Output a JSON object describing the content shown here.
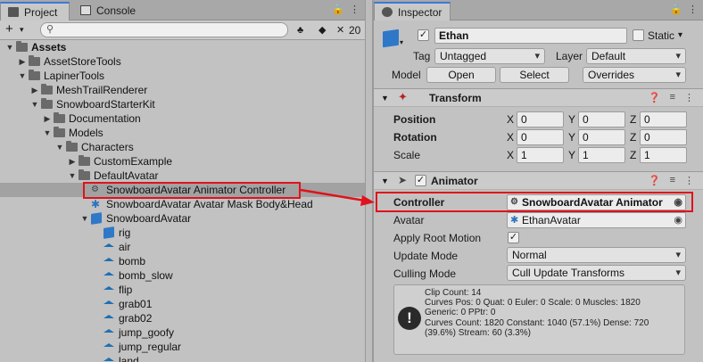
{
  "project_panel": {
    "tab_project": "Project",
    "tab_console": "Console",
    "add_label": "+",
    "search_placeholder": "",
    "hidden_count": "20"
  },
  "tree": [
    {
      "label": "Assets",
      "depth": 0,
      "expanded": true,
      "icon": "folder-icon",
      "bold": true
    },
    {
      "label": "AssetStoreTools",
      "depth": 1,
      "expanded": false,
      "icon": "folder-icon"
    },
    {
      "label": "LapinerTools",
      "depth": 1,
      "expanded": true,
      "icon": "folder-icon"
    },
    {
      "label": "MeshTrailRenderer",
      "depth": 2,
      "expanded": false,
      "icon": "folder-icon"
    },
    {
      "label": "SnowboardStarterKit",
      "depth": 2,
      "expanded": true,
      "icon": "folder-icon"
    },
    {
      "label": "Documentation",
      "depth": 3,
      "expanded": false,
      "icon": "folder-icon"
    },
    {
      "label": "Models",
      "depth": 3,
      "expanded": true,
      "icon": "folder-icon"
    },
    {
      "label": "Characters",
      "depth": 4,
      "expanded": true,
      "icon": "folder-icon"
    },
    {
      "label": "CustomExample",
      "depth": 5,
      "expanded": false,
      "icon": "folder-icon"
    },
    {
      "label": "DefaultAvatar",
      "depth": 5,
      "expanded": true,
      "icon": "folder-icon"
    },
    {
      "label": "SnowboardAvatar Animator Controller",
      "depth": 6,
      "icon": "animator-controller-icon",
      "selected": true
    },
    {
      "label": "SnowboardAvatar Avatar Mask Body&Head",
      "depth": 6,
      "icon": "avatar-mask-icon"
    },
    {
      "label": "SnowboardAvatar",
      "depth": 6,
      "expanded": true,
      "icon": "model-icon"
    },
    {
      "label": "rig",
      "depth": 7,
      "icon": "mesh-icon"
    },
    {
      "label": "air",
      "depth": 7,
      "icon": "animation-clip-icon"
    },
    {
      "label": "bomb",
      "depth": 7,
      "icon": "animation-clip-icon"
    },
    {
      "label": "bomb_slow",
      "depth": 7,
      "icon": "animation-clip-icon"
    },
    {
      "label": "flip",
      "depth": 7,
      "icon": "animation-clip-icon"
    },
    {
      "label": "grab01",
      "depth": 7,
      "icon": "animation-clip-icon"
    },
    {
      "label": "grab02",
      "depth": 7,
      "icon": "animation-clip-icon"
    },
    {
      "label": "jump_goofy",
      "depth": 7,
      "icon": "animation-clip-icon"
    },
    {
      "label": "jump_regular",
      "depth": 7,
      "icon": "animation-clip-icon"
    },
    {
      "label": "land",
      "depth": 7,
      "icon": "animation-clip-icon"
    }
  ],
  "inspector": {
    "tab": "Inspector",
    "object_name": "Ethan",
    "static_label": "Static",
    "tag_label": "Tag",
    "tag_value": "Untagged",
    "layer_label": "Layer",
    "layer_value": "Default",
    "model_label": "Model",
    "open_button": "Open",
    "select_button": "Select",
    "overrides_value": "Overrides",
    "transform": {
      "title": "Transform",
      "position_label": "Position",
      "rotation_label": "Rotation",
      "scale_label": "Scale",
      "x": "X",
      "y": "Y",
      "z": "Z",
      "position": [
        "0",
        "0",
        "0"
      ],
      "rotation": [
        "0",
        "0",
        "0"
      ],
      "scale": [
        "1",
        "1",
        "1"
      ]
    },
    "animator": {
      "title": "Animator",
      "controller_label": "Controller",
      "controller_value": "SnowboardAvatar Animator",
      "avatar_label": "Avatar",
      "avatar_value": "EthanAvatar",
      "apply_root_motion_label": "Apply Root Motion",
      "update_mode_label": "Update Mode",
      "update_mode_value": "Normal",
      "culling_mode_label": "Culling Mode",
      "culling_mode_value": "Cull Update Transforms",
      "info_icon": "!",
      "info_text": "Clip Count: 14\nCurves Pos: 0 Quat: 0 Euler: 0 Scale: 0 Muscles: 1820\nGeneric: 0 PPtr: 0\nCurves Count: 1820 Constant: 1040 (57.1%) Dense: 720\n(39.6%) Stream: 60 (3.3%)"
    }
  },
  "colors": {
    "accent": "#3a79d8",
    "highlight_red": "#e0121b",
    "selection": "#a2a2a2"
  }
}
